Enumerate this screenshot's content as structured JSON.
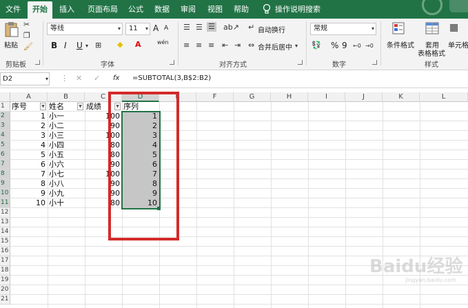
{
  "tabs": [
    {
      "label": "文件"
    },
    {
      "label": "开始",
      "active": true
    },
    {
      "label": "插入"
    },
    {
      "label": "页面布局"
    },
    {
      "label": "公式"
    },
    {
      "label": "数据"
    },
    {
      "label": "审阅"
    },
    {
      "label": "视图"
    },
    {
      "label": "帮助"
    }
  ],
  "tell_me": "操作说明搜索",
  "ribbon": {
    "clipboard": {
      "paste": "粘贴",
      "group": "剪贴板"
    },
    "font": {
      "name": "等线",
      "size": "11",
      "grow": "A",
      "shrink": "A",
      "bold": "B",
      "italic": "I",
      "underline": "U",
      "wen": "wén",
      "group": "字体"
    },
    "alignment": {
      "wrap": "自动换行",
      "merge": "合并后居中",
      "group": "对齐方式"
    },
    "number": {
      "format": "常规",
      "percent": "%",
      "comma": "9",
      "group": "数字"
    },
    "styles": {
      "conditional": "条件格式",
      "table_format_1": "套用",
      "table_format_2": "表格格式",
      "cell_style": "单元格",
      "group": "样式"
    }
  },
  "formula_bar": {
    "name_box": "D2",
    "fx": "fx",
    "formula": "=SUBTOTAL(3,B$2:B2)"
  },
  "columns": [
    "A",
    "B",
    "C",
    "D",
    "E",
    "F",
    "G",
    "H",
    "I",
    "J",
    "K",
    "L"
  ],
  "row_numbers": [
    "1",
    "2",
    "3",
    "4",
    "5",
    "6",
    "7",
    "8",
    "9",
    "10",
    "11",
    "12",
    "13",
    "14",
    "15",
    "16",
    "17",
    "18",
    "19",
    "20",
    "21"
  ],
  "headers": {
    "a": "序号",
    "b": "姓名",
    "c": "成绩",
    "d": "序列"
  },
  "rows": [
    {
      "a": "1",
      "b": "小一",
      "c": "100",
      "d": "1"
    },
    {
      "a": "2",
      "b": "小二",
      "c": "90",
      "d": "2"
    },
    {
      "a": "3",
      "b": "小三",
      "c": "100",
      "d": "3"
    },
    {
      "a": "4",
      "b": "小四",
      "c": "80",
      "d": "4"
    },
    {
      "a": "5",
      "b": "小五",
      "c": "80",
      "d": "5"
    },
    {
      "a": "6",
      "b": "小六",
      "c": "90",
      "d": "6"
    },
    {
      "a": "7",
      "b": "小七",
      "c": "100",
      "d": "7"
    },
    {
      "a": "8",
      "b": "小八",
      "c": "90",
      "d": "8"
    },
    {
      "a": "9",
      "b": "小九",
      "c": "90",
      "d": "9"
    },
    {
      "a": "10",
      "b": "小十",
      "c": "80",
      "d": "10"
    }
  ],
  "watermark": "Baidu经验",
  "watermark_sub": "jingyan.baidu.com",
  "colors": {
    "accent": "#217346",
    "highlight": "#d42a2a",
    "selection": "#c6c6c6"
  }
}
